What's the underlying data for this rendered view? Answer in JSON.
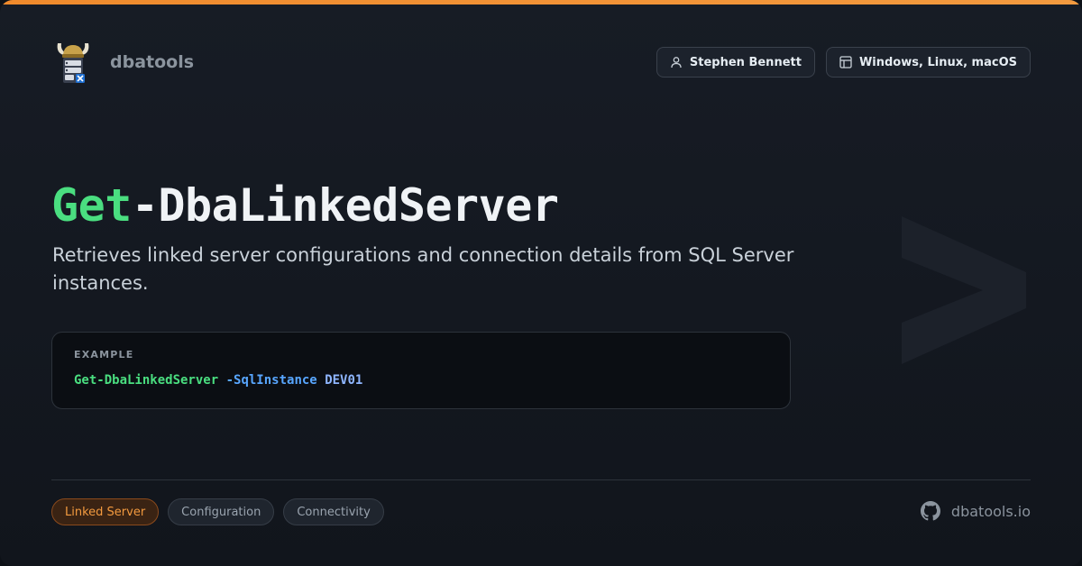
{
  "brand": {
    "name": "dbatools",
    "logo_icon": "viking-server-icon"
  },
  "meta": {
    "author": "Stephen Bennett",
    "author_icon": "user-icon",
    "platforms": "Windows, Linux, macOS",
    "platforms_icon": "window-layout-icon"
  },
  "command": {
    "verb": "Get",
    "noun": "-DbaLinkedServer",
    "description": "Retrieves linked server configurations and connection details from SQL Server instances."
  },
  "example": {
    "label": "EXAMPLE",
    "command": "Get-DbaLinkedServer",
    "parameter": "-SqlInstance",
    "value": "DEV01"
  },
  "tags": [
    {
      "label": "Linked Server"
    },
    {
      "label": "Configuration"
    },
    {
      "label": "Connectivity"
    }
  ],
  "footer": {
    "site": "dbatools.io",
    "site_icon": "github-icon"
  },
  "colors": {
    "accent": "#f08a2c",
    "verb": "#4ade80",
    "parameter": "#58a6ff",
    "background": "#11151c"
  },
  "watermark_icon": "chevron-right-prompt-icon"
}
